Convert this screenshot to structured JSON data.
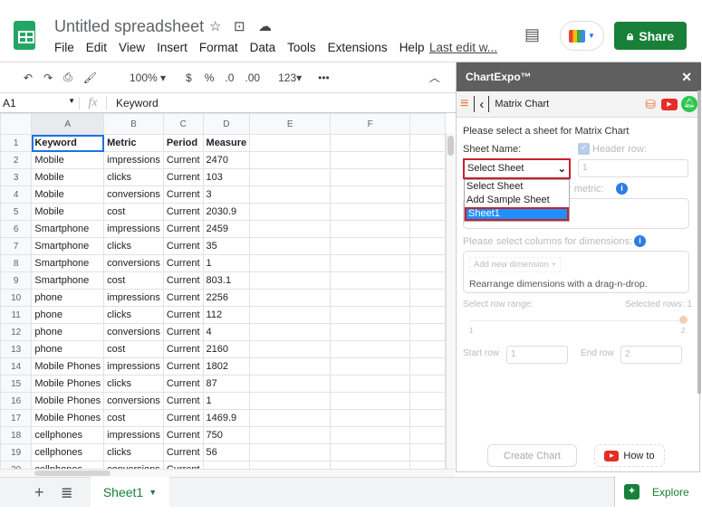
{
  "app": {
    "title": "Untitled spreadsheet",
    "menu": [
      "File",
      "Edit",
      "View",
      "Insert",
      "Format",
      "Data",
      "Tools",
      "Extensions",
      "Help"
    ],
    "last_edit": "Last edit w...",
    "share": "Share"
  },
  "toolbar": {
    "zoom": "100%",
    "currency": "$",
    "percent": "%",
    "dec_decrease": ".0",
    "dec_increase": ".00",
    "format": "123",
    "more": "•••"
  },
  "formula_bar": {
    "cell_ref": "A1",
    "fx": "fx",
    "value": "Keyword"
  },
  "grid": {
    "columns": [
      "A",
      "B",
      "C",
      "D",
      "E",
      "F"
    ],
    "rows": [
      [
        "Keyword",
        "Metric",
        "Period",
        "Measure"
      ],
      [
        "Mobile",
        "impressions",
        "Current",
        "2470"
      ],
      [
        "Mobile",
        "clicks",
        "Current",
        "103"
      ],
      [
        "Mobile",
        "conversions",
        "Current",
        "3"
      ],
      [
        "Mobile",
        "cost",
        "Current",
        "2030.9"
      ],
      [
        "Smartphone",
        "impressions",
        "Current",
        "2459"
      ],
      [
        "Smartphone",
        "clicks",
        "Current",
        "35"
      ],
      [
        "Smartphone",
        "conversions",
        "Current",
        "1"
      ],
      [
        "Smartphone",
        "cost",
        "Current",
        "803.1"
      ],
      [
        "phone",
        "impressions",
        "Current",
        "2256"
      ],
      [
        "phone",
        "clicks",
        "Current",
        "112"
      ],
      [
        "phone",
        "conversions",
        "Current",
        "4"
      ],
      [
        "phone",
        "cost",
        "Current",
        "2160"
      ],
      [
        "Mobile Phones",
        "impressions",
        "Current",
        "1802"
      ],
      [
        "Mobile Phones",
        "clicks",
        "Current",
        "87"
      ],
      [
        "Mobile Phones",
        "conversions",
        "Current",
        "1"
      ],
      [
        "Mobile Phones",
        "cost",
        "Current",
        "1469.9"
      ],
      [
        "cellphones",
        "impressions",
        "Current",
        "750"
      ],
      [
        "cellphones",
        "clicks",
        "Current",
        "56"
      ],
      [
        "cellphones",
        "conversions",
        "Current",
        ""
      ]
    ]
  },
  "sheets": {
    "tabs": [
      "Sheet1"
    ],
    "explore": "Explore"
  },
  "panel": {
    "title": "ChartExpo™",
    "close": "✕",
    "nav_title": "Matrix Chart",
    "prompt": "Please select a sheet for Matrix Chart",
    "sheet_name_label": "Sheet Name:",
    "header_row_label": "Header row:",
    "header_row_value": "1",
    "sheet_select_value": "Select Sheet",
    "options": [
      "Select Sheet",
      "Add Sample Sheet",
      "Sheet1"
    ],
    "metric_label_visible": "r metric:",
    "dimensions_label": "Please select columns for dimensions:",
    "add_dimension": "Add new dimension +",
    "rearrange_hint": "Rearrange dimensions with a drag-n-drop.",
    "row_range_label": "Select row range:",
    "selected_rows": "Selected rows: 1",
    "slider_min": "1",
    "slider_max": "2",
    "start_row_label": "Start row",
    "start_row": "1",
    "end_row_label": "End row",
    "end_row": "2",
    "create_chart": "Create Chart",
    "how_to": "How to"
  },
  "colors": {
    "share": "#188038",
    "panel_header": "#5f5f5f",
    "highlight": "#1e90ff",
    "outline": "#c8202e"
  }
}
